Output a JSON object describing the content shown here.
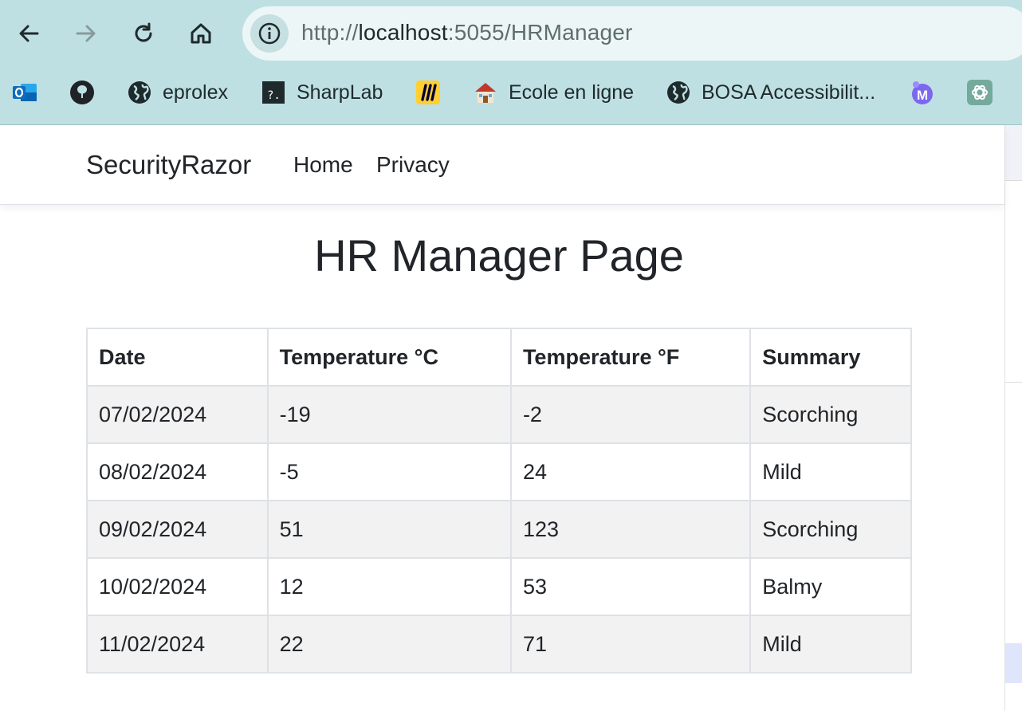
{
  "browser": {
    "url": {
      "scheme": "http://",
      "host": "localhost",
      "rest": ":5055/HRManager"
    },
    "bookmarks": [
      {
        "label": "",
        "icon": "outlook-icon"
      },
      {
        "label": "",
        "icon": "github-icon"
      },
      {
        "label": "eprolex",
        "icon": "globe-icon"
      },
      {
        "label": "SharpLab",
        "icon": "terminal-icon"
      },
      {
        "label": "",
        "icon": "miro-icon"
      },
      {
        "label": "Ecole en ligne",
        "icon": "school-icon"
      },
      {
        "label": "BOSA Accessibilit...",
        "icon": "globe-icon"
      },
      {
        "label": "",
        "icon": "m-app-icon"
      },
      {
        "label": "",
        "icon": "chatgpt-icon"
      }
    ]
  },
  "navbar": {
    "brand": "SecurityRazor",
    "links": [
      "Home",
      "Privacy"
    ]
  },
  "main": {
    "title": "HR Manager Page",
    "table": {
      "headers": [
        "Date",
        "Temperature °C",
        "Temperature °F",
        "Summary"
      ],
      "rows": [
        [
          "07/02/2024",
          "-19",
          "-2",
          "Scorching"
        ],
        [
          "08/02/2024",
          "-5",
          "24",
          "Mild"
        ],
        [
          "09/02/2024",
          "51",
          "123",
          "Scorching"
        ],
        [
          "10/02/2024",
          "12",
          "53",
          "Balmy"
        ],
        [
          "11/02/2024",
          "22",
          "71",
          "Mild"
        ]
      ]
    }
  },
  "colors": {
    "chrome": "#bfe0e3",
    "urlbar": "#ecf6f7",
    "stripe": "#f2f2f2",
    "border": "#dee2e6"
  }
}
